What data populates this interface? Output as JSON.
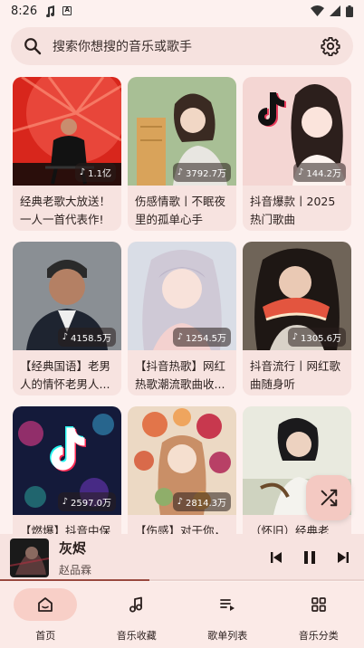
{
  "status_bar": {
    "time": "8:26"
  },
  "search": {
    "placeholder": "搜索你想搜的音乐或歌手"
  },
  "playlists": [
    {
      "title": "经典老歌大放送！一人一首代表作!",
      "plays": "1.1亿"
    },
    {
      "title": "伤感情歌丨不眠夜里的孤单心手",
      "plays": "3792.7万"
    },
    {
      "title": "抖音爆款丨2025热门歌曲",
      "plays": "144.2万"
    },
    {
      "title": "【经典国语】老男人的情怀老男人...",
      "plays": "4158.5万"
    },
    {
      "title": "【抖音热歌】网红热歌潮流歌曲收...",
      "plays": "1254.5万"
    },
    {
      "title": "抖音流行丨网红歌曲随身听",
      "plays": "1305.6万"
    },
    {
      "title": "【燃爆】抖音中保",
      "plays": "2597.0万"
    },
    {
      "title": "【伤感】对于你，",
      "plays": "2814.3万"
    },
    {
      "title": "（怀旧）经典老",
      "plays": ""
    }
  ],
  "player": {
    "song": "灰烬",
    "artist": "赵品霖",
    "progress": 0.41
  },
  "nav": [
    {
      "label": "首页",
      "active": true,
      "icon": "home-icon"
    },
    {
      "label": "音乐收藏",
      "active": false,
      "icon": "music-note-icon"
    },
    {
      "label": "歌单列表",
      "active": false,
      "icon": "playlist-icon"
    },
    {
      "label": "音乐分类",
      "active": false,
      "icon": "category-grid-icon"
    }
  ],
  "colors": {
    "accent": "#9a4a40",
    "surface": "#f7e3e0",
    "background": "#fdf1ef"
  }
}
